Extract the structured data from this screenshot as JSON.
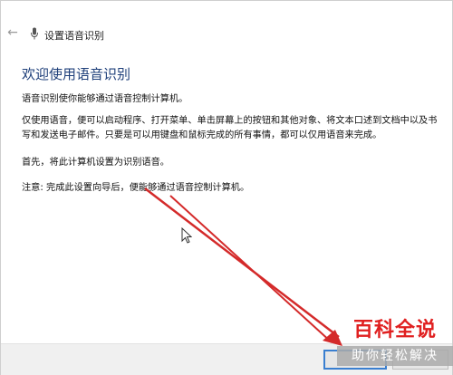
{
  "window": {
    "title": "设置语音识别",
    "back_icon": "back-arrow-icon",
    "title_icon": "microphone-icon"
  },
  "content": {
    "heading": "欢迎使用语音识别",
    "paragraph1": "语音识别使你能够通过语音控制计算机。",
    "paragraph2_line1": "仅使用语音，便可以启动程序、打开菜单、单击屏幕上的按钮和其他对象、将文本口述到文档中以及书",
    "paragraph2_line2": "写和发送电子邮件。只要是可以用键盘和鼠标完成的所有事情，都可以仅用语音来完成。",
    "paragraph3": "首先，将此计算机设置为识别语音。",
    "paragraph4": "注意: 完成此设置向导后，便能够通过语音控制计算机。"
  },
  "watermark": {
    "main": "百科全说",
    "sub": "助你轻松解决"
  },
  "colors": {
    "heading": "#1e3f7a",
    "arrow": "#d42a2a",
    "primary_button_border": "#3a7fd0",
    "watermark_red": "#e02020"
  }
}
